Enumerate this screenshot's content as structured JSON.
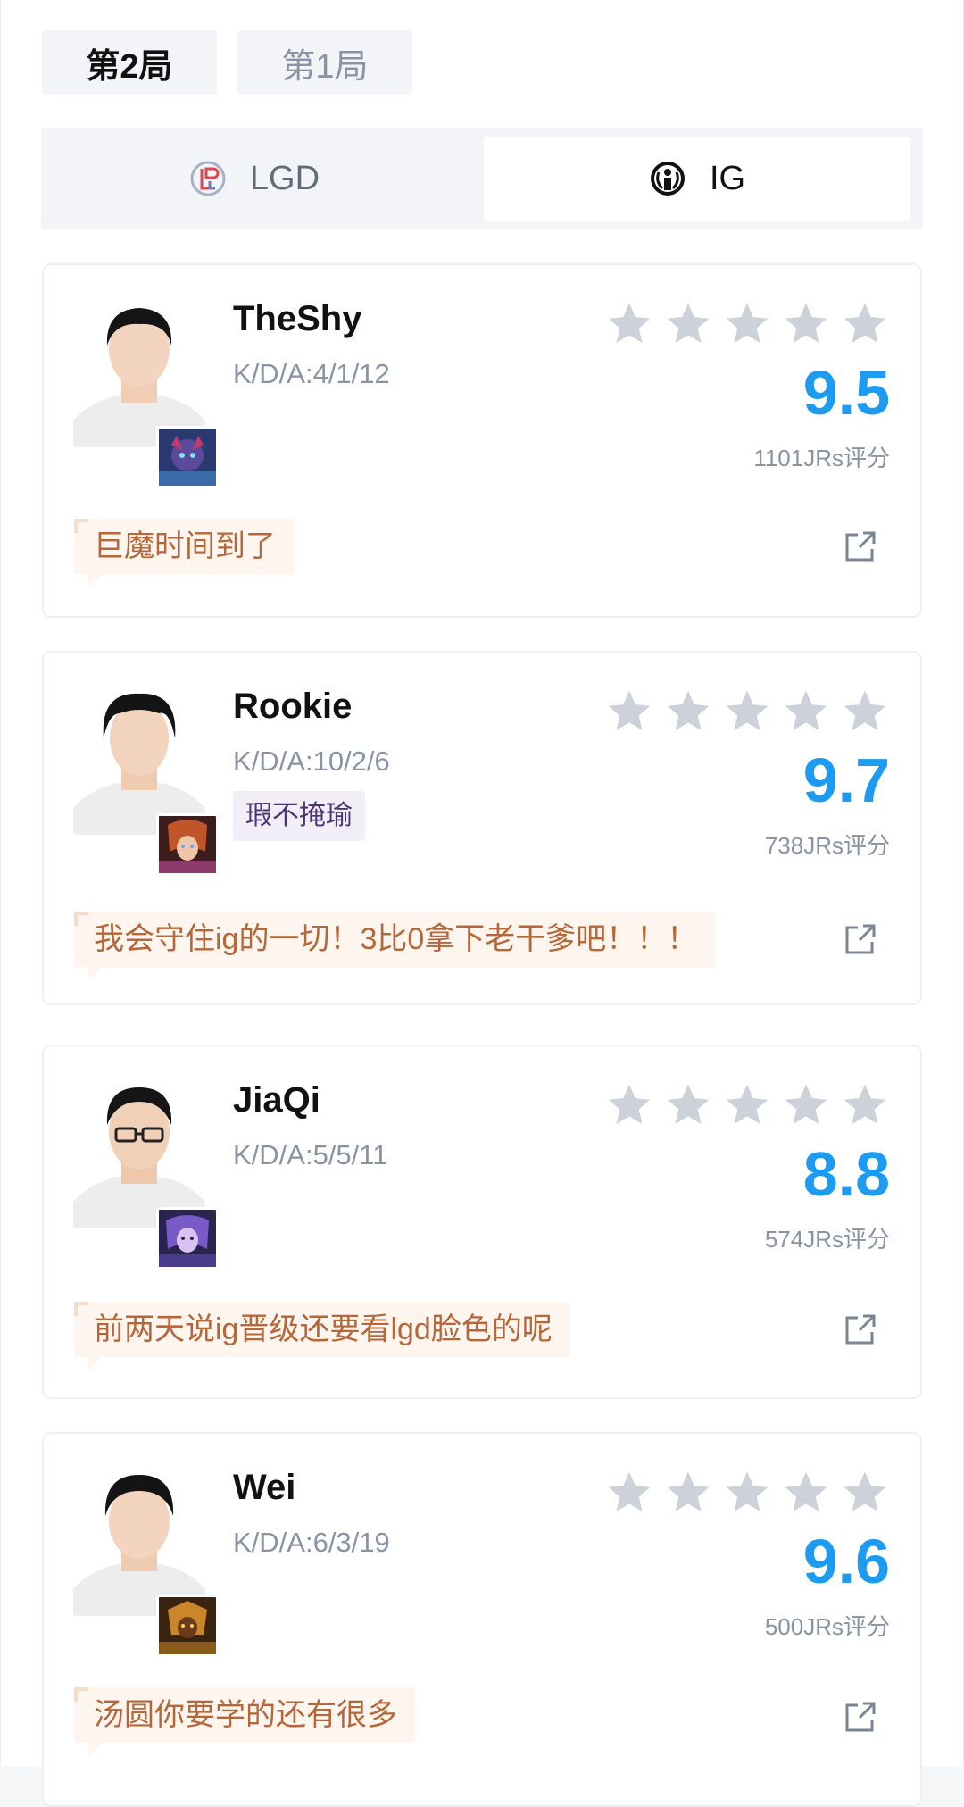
{
  "game_tabs": [
    {
      "label": "第2局",
      "active": true
    },
    {
      "label": "第1局",
      "active": false
    }
  ],
  "teams": [
    {
      "name": "LGD",
      "logo": "lgd-logo-icon",
      "selected": false
    },
    {
      "name": "IG",
      "logo": "ig-logo-icon",
      "selected": true
    }
  ],
  "players": [
    {
      "name": "TheShy",
      "kda": "K/D/A:4/1/12",
      "badge": "",
      "rating": "9.5",
      "votes": "1101JRs评分",
      "comment": "巨魔时间到了",
      "stars_filled": 0,
      "champion_icon": "trundle-champion-icon"
    },
    {
      "name": "Rookie",
      "kda": "K/D/A:10/2/6",
      "badge": "瑕不掩瑜",
      "rating": "9.7",
      "votes": "738JRs评分",
      "comment": "我会守住ig的一切！3比0拿下老干爹吧！！！",
      "stars_filled": 0,
      "champion_icon": "champion-icon"
    },
    {
      "name": "JiaQi",
      "kda": "K/D/A:5/5/11",
      "badge": "",
      "rating": "8.8",
      "votes": "574JRs评分",
      "comment": "前两天说ig晋级还要看lgd脸色的呢",
      "stars_filled": 0,
      "champion_icon": "champion-icon"
    },
    {
      "name": "Wei",
      "kda": "K/D/A:6/3/19",
      "badge": "",
      "rating": "9.6",
      "votes": "500JRs评分",
      "comment": "汤圆你要学的还有很多",
      "stars_filled": 0,
      "champion_icon": "champion-icon"
    }
  ],
  "colors": {
    "accent_blue": "#1d9bf0",
    "star_gray": "#ccd1da",
    "comment_text": "#b5673a",
    "comment_bg": "#fdf5ee",
    "badge_text": "#4c3575",
    "badge_bg": "#f1eef8"
  }
}
